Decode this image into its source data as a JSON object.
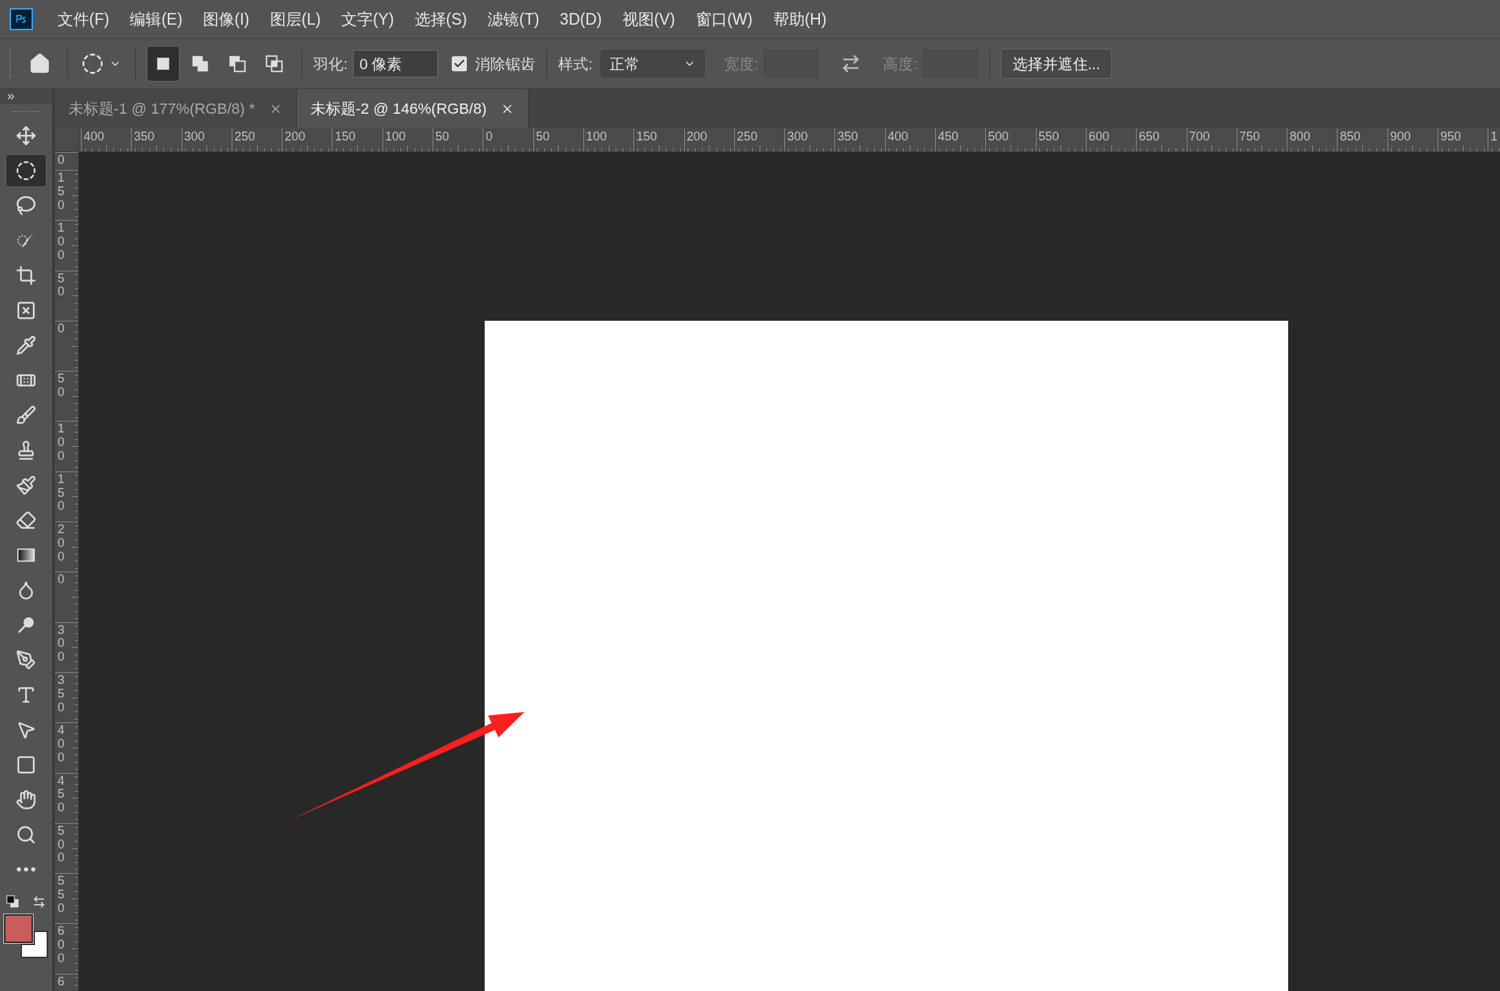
{
  "menu_bar": {
    "items": [
      "文件(F)",
      "编辑(E)",
      "图像(I)",
      "图层(L)",
      "文字(Y)",
      "选择(S)",
      "滤镜(T)",
      "3D(D)",
      "视图(V)",
      "窗口(W)",
      "帮助(H)"
    ]
  },
  "options_bar": {
    "mode_buttons": [
      {
        "kind": "new",
        "selected": true
      },
      {
        "kind": "add",
        "selected": false
      },
      {
        "kind": "subtract",
        "selected": false
      },
      {
        "kind": "intersect",
        "selected": false
      }
    ],
    "feather": {
      "label": "羽化:",
      "value": "0 像素"
    },
    "anti_alias": {
      "label": "消除锯齿",
      "checked": true
    },
    "style": {
      "label": "样式:",
      "value": "正常"
    },
    "width": {
      "label": "宽度:",
      "disabled": true
    },
    "height": {
      "label": "高度:",
      "disabled": true
    },
    "refine_button": "选择并遮住..."
  },
  "tabs": [
    {
      "title": "未标题-1 @ 177%(RGB/8) *",
      "selected": false
    },
    {
      "title": "未标题-2 @ 146%(RGB/8)",
      "selected": true
    }
  ],
  "rulers": {
    "horizontal": [
      "400",
      "350",
      "300",
      "250",
      "200",
      "150",
      "100",
      "50",
      "0",
      "50",
      "100",
      "150",
      "200",
      "250",
      "300",
      "350",
      "400",
      "450",
      "500",
      "550",
      "600",
      "650",
      "700",
      "750",
      "800",
      "850",
      "900",
      "950",
      "1"
    ],
    "vertical": [
      "0",
      "150",
      "100",
      "50",
      "0",
      "50",
      "100",
      "150",
      "200",
      "0",
      "300",
      "350",
      "400",
      "450",
      "500",
      "550",
      "600",
      "6"
    ]
  },
  "tools": [
    {
      "kind": "move",
      "selected": false
    },
    {
      "kind": "marquee",
      "selected": true
    },
    {
      "kind": "lasso",
      "selected": false
    },
    {
      "kind": "quick-select",
      "selected": false
    },
    {
      "kind": "crop",
      "selected": false
    },
    {
      "kind": "frame",
      "selected": false
    },
    {
      "kind": "eyedropper",
      "selected": false
    },
    {
      "kind": "healing",
      "selected": false
    },
    {
      "kind": "brush",
      "selected": false
    },
    {
      "kind": "stamp",
      "selected": false
    },
    {
      "kind": "history-brush",
      "selected": false
    },
    {
      "kind": "eraser",
      "selected": false
    },
    {
      "kind": "gradient",
      "selected": false
    },
    {
      "kind": "blur",
      "selected": false
    },
    {
      "kind": "dodge",
      "selected": false
    },
    {
      "kind": "pen",
      "selected": false
    },
    {
      "kind": "type",
      "selected": false
    },
    {
      "kind": "path-select",
      "selected": false
    },
    {
      "kind": "rectangle",
      "selected": false
    },
    {
      "kind": "hand",
      "selected": false
    },
    {
      "kind": "zoom",
      "selected": false
    },
    {
      "kind": "more",
      "selected": false
    }
  ],
  "color_swatches": [
    {
      "kind": "foreground",
      "color": "#c95c5c"
    },
    {
      "kind": "background",
      "color": "#ffffff"
    }
  ]
}
